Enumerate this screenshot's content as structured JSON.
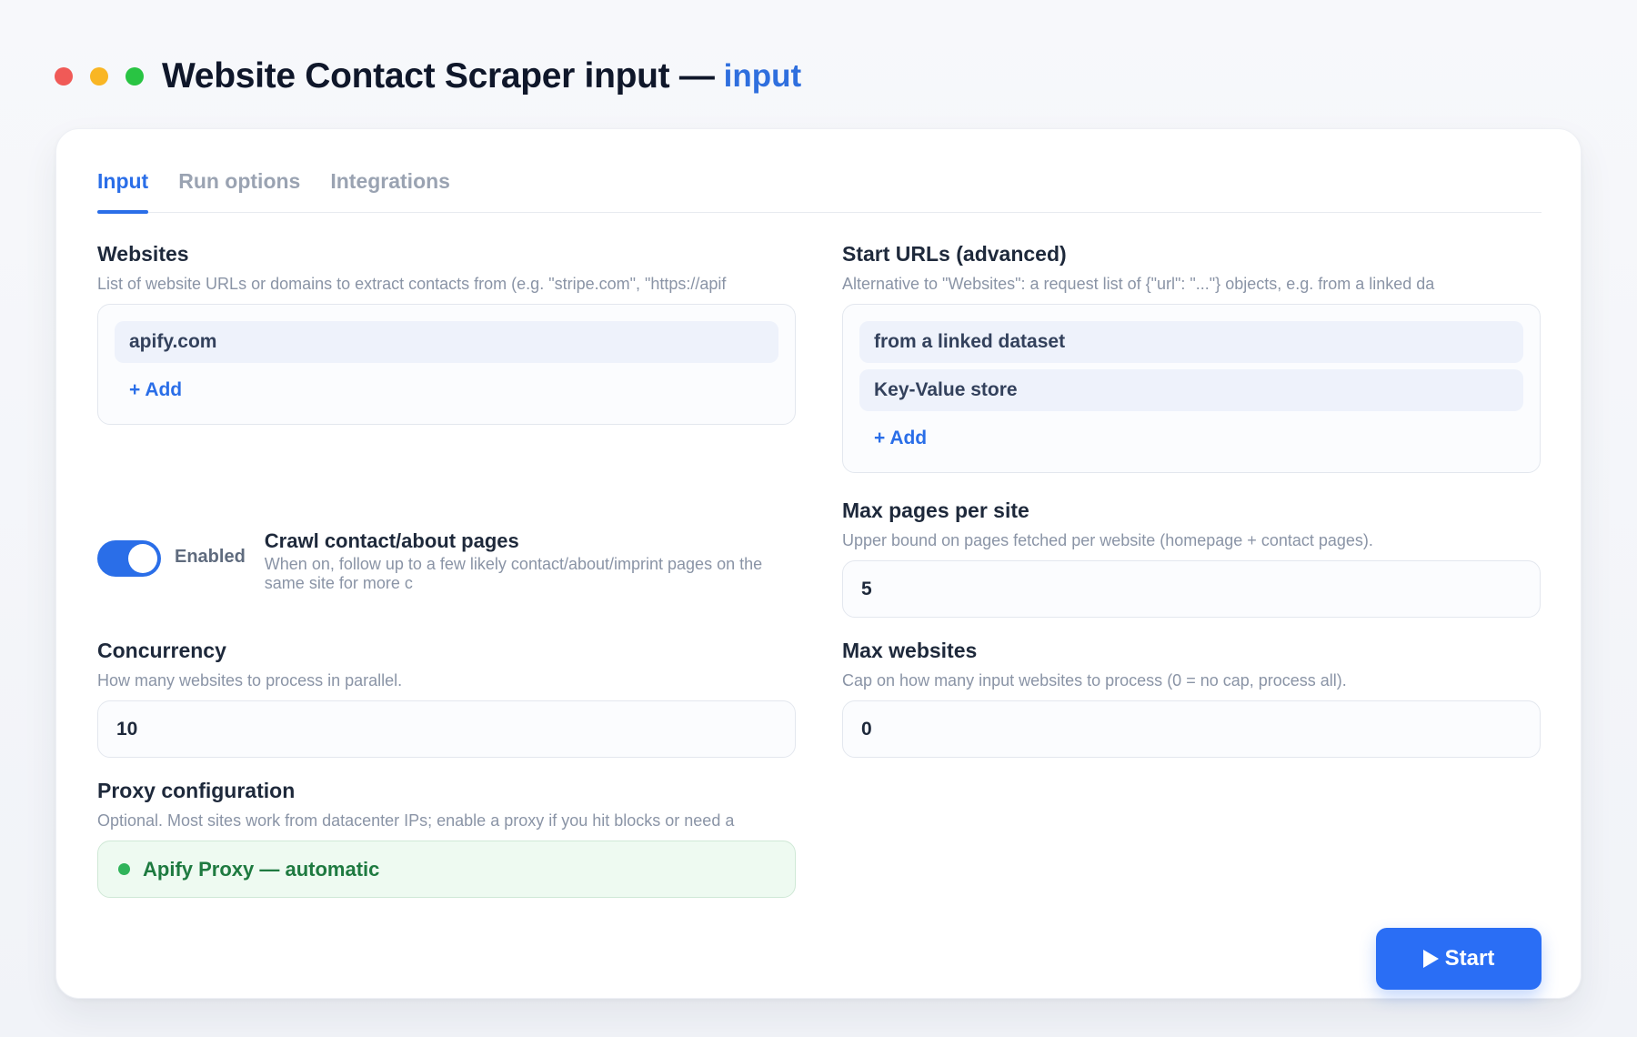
{
  "window": {
    "title": "Website Contact Scraper input —",
    "title_accent": "input"
  },
  "tabs": [
    {
      "label": "Input",
      "active": true
    },
    {
      "label": "Run options",
      "active": false
    },
    {
      "label": "Integrations",
      "active": false
    }
  ],
  "websites": {
    "label": "Websites",
    "description": "List of website URLs or domains to extract contacts from (e.g. \"stripe.com\", \"https://apif",
    "items": [
      "apify.com"
    ],
    "add_label": "+ Add"
  },
  "start_urls": {
    "label": "Start URLs (advanced)",
    "description": "Alternative to \"Websites\": a request list of {\"url\": \"...\"} objects, e.g. from a linked da",
    "items": [
      "from a linked dataset",
      "Key-Value store"
    ],
    "add_label": "+ Add"
  },
  "crawl_contact": {
    "state_label": "Enabled",
    "enabled": true,
    "title": "Crawl contact/about pages",
    "description": "When on, follow up to a few likely contact/about/imprint pages on the same site for more c"
  },
  "max_pages": {
    "label": "Max pages per site",
    "description": "Upper bound on pages fetched per website (homepage + contact pages).",
    "value": "5"
  },
  "concurrency": {
    "label": "Concurrency",
    "description": "How many websites to process in parallel.",
    "value": "10"
  },
  "max_websites": {
    "label": "Max websites",
    "description": "Cap on how many input websites to process (0 = no cap, process all).",
    "value": "0"
  },
  "proxy": {
    "label": "Proxy configuration",
    "description": "Optional. Most sites work from datacenter IPs; enable a proxy if you hit blocks or need a",
    "value": "Apify Proxy — automatic"
  },
  "actions": {
    "start_label": "Start"
  },
  "colors": {
    "accent": "#2a6ee8",
    "proxy_green": "#1e7a40",
    "close": "#f05a57",
    "minimize": "#f9b624",
    "maximize": "#29c443"
  }
}
